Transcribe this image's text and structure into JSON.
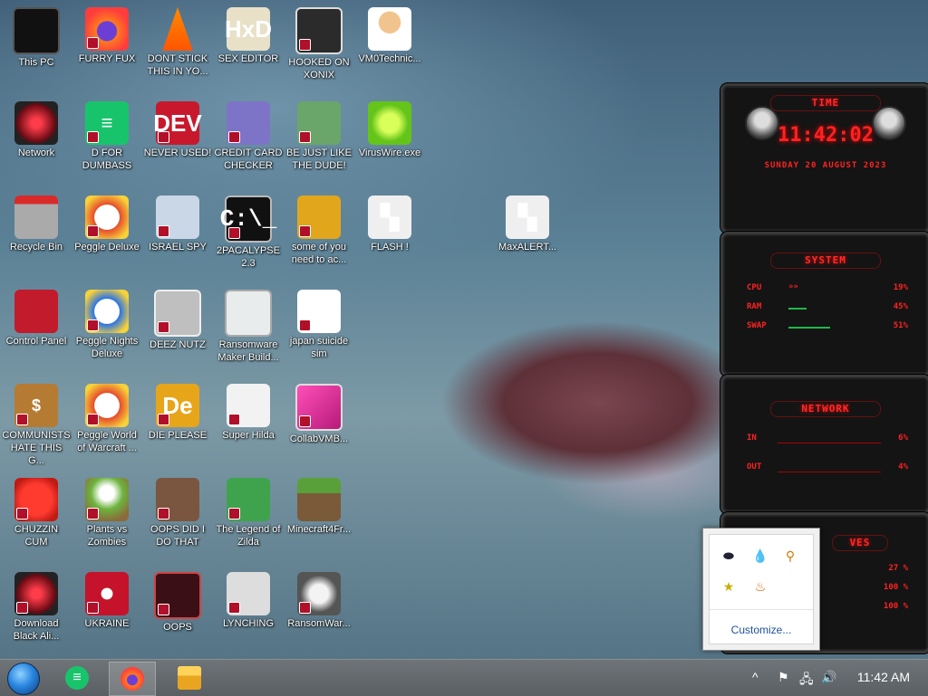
{
  "desktop_icons": [
    {
      "label": "This PC"
    },
    {
      "label": "FURRY FUX"
    },
    {
      "label": "DONT STICK THIS IN YO..."
    },
    {
      "label": "SEX EDITOR"
    },
    {
      "label": "HOOKED ON XONIX"
    },
    {
      "label": "VM0Technic..."
    },
    {
      "label": "Network"
    },
    {
      "label": "D FOR DUMBASS"
    },
    {
      "label": "NEVER USED!"
    },
    {
      "label": "CREDIT CARD CHECKER"
    },
    {
      "label": "BE JUST LIKE THE DUDE!"
    },
    {
      "label": "VirusWire.exe"
    },
    {
      "label": "Recycle Bin"
    },
    {
      "label": "Peggle Deluxe"
    },
    {
      "label": "ISRAEL SPY"
    },
    {
      "label": "2PACALYPSE 2.3"
    },
    {
      "label": "some of you need to ac..."
    },
    {
      "label": "FLASH !"
    },
    {
      "label": "MaxALERT..."
    },
    {
      "label": "Control Panel"
    },
    {
      "label": "Peggle Nights Deluxe"
    },
    {
      "label": "DEEZ NUTZ"
    },
    {
      "label": "Ransomware Maker Build..."
    },
    {
      "label": "japan suicide sim"
    },
    {
      "label": "COMMUNISTS HATE THIS G..."
    },
    {
      "label": "Peggle World of Warcraft ..."
    },
    {
      "label": "DIE PLEASE"
    },
    {
      "label": "Super Hilda"
    },
    {
      "label": "CollabVMB..."
    },
    {
      "label": "CHUZZIN CUM"
    },
    {
      "label": "Plants vs Zombies"
    },
    {
      "label": "OOPS DID I DO THAT"
    },
    {
      "label": "The Legend of Zilda"
    },
    {
      "label": "Minecraft4Fr..."
    },
    {
      "label": "Download Black Ali..."
    },
    {
      "label": "UKRAINE"
    },
    {
      "label": "OOPS"
    },
    {
      "label": "LYNCHING"
    },
    {
      "label": "RansomWar..."
    }
  ],
  "gadgets": {
    "time": {
      "title": "TIME",
      "clock": "11:42:02",
      "date": "SUNDAY 20 AUGUST 2023"
    },
    "system": {
      "title": "SYSTEM",
      "rows": [
        {
          "label": "CPU",
          "value": "19%"
        },
        {
          "label": "RAM",
          "value": "45%"
        },
        {
          "label": "SWAP",
          "value": "51%"
        }
      ]
    },
    "network": {
      "title": "NETWORK",
      "rows": [
        {
          "label": "IN",
          "value": "6%"
        },
        {
          "label": "OUT",
          "value": "4%"
        }
      ]
    },
    "drives": {
      "title": "VES",
      "rows": [
        {
          "label": "",
          "value": "27 %"
        },
        {
          "label": "",
          "value": "100 %"
        },
        {
          "label": "",
          "value": "100 %"
        }
      ]
    }
  },
  "tray_popup": {
    "customize_label": "Customize..."
  },
  "taskbar": {
    "clock": "11:42 AM"
  }
}
